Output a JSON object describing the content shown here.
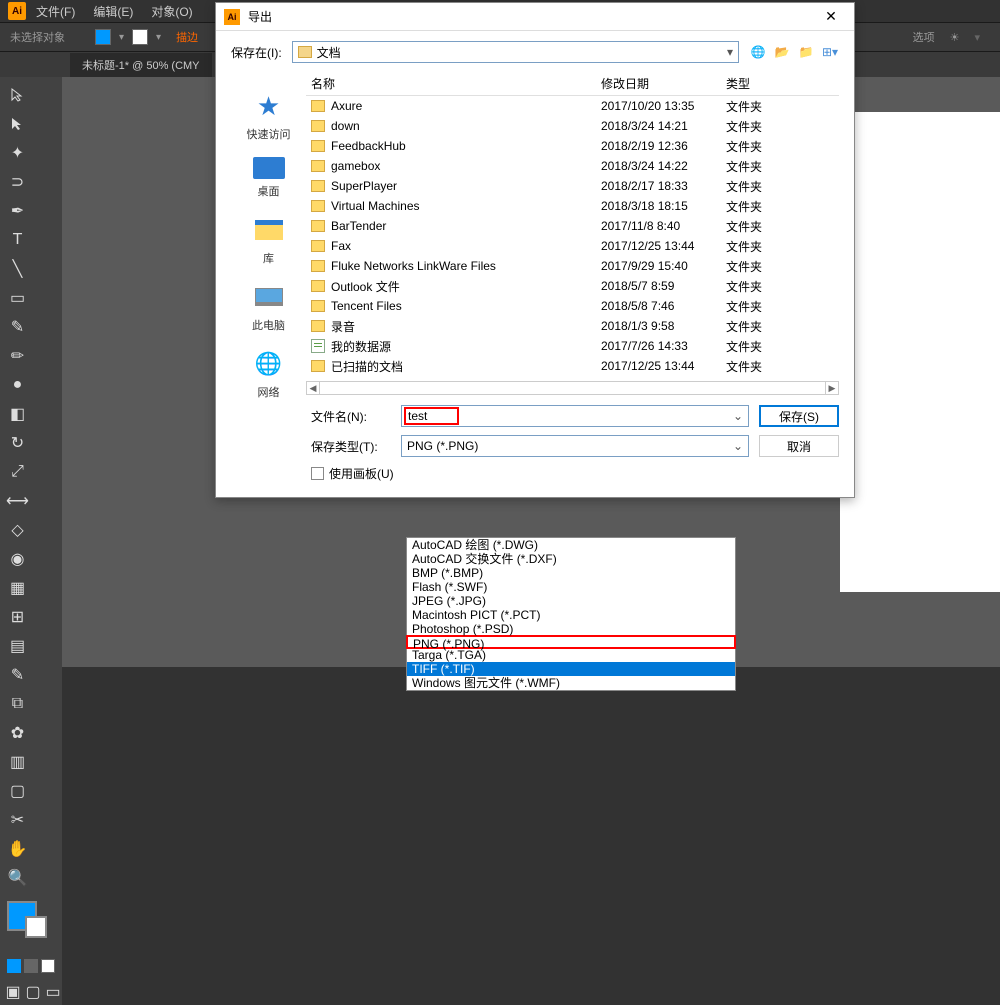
{
  "app": {
    "menu": [
      "文件(F)",
      "编辑(E)",
      "对象(O)"
    ],
    "no_selection": "未选择对象",
    "highlight": "描边",
    "right_opts": "选项",
    "doc_tab": "未标题-1* @ 50% (CMY"
  },
  "dialog": {
    "title": "导出",
    "save_in_label": "保存在(I):",
    "location": "文档",
    "sidebar": [
      {
        "label": "快速访问",
        "icon": "star"
      },
      {
        "label": "桌面",
        "icon": "desktop"
      },
      {
        "label": "库",
        "icon": "library"
      },
      {
        "label": "此电脑",
        "icon": "computer"
      },
      {
        "label": "网络",
        "icon": "network"
      }
    ],
    "headers": {
      "name": "名称",
      "date": "修改日期",
      "type": "类型"
    },
    "files": [
      {
        "name": "Axure",
        "date": "2017/10/20 13:35",
        "type": "文件夹"
      },
      {
        "name": "down",
        "date": "2018/3/24 14:21",
        "type": "文件夹"
      },
      {
        "name": "FeedbackHub",
        "date": "2018/2/19 12:36",
        "type": "文件夹"
      },
      {
        "name": "gamebox",
        "date": "2018/3/24 14:22",
        "type": "文件夹"
      },
      {
        "name": "SuperPlayer",
        "date": "2018/2/17 18:33",
        "type": "文件夹"
      },
      {
        "name": "Virtual Machines",
        "date": "2018/3/18 18:15",
        "type": "文件夹"
      },
      {
        "name": "BarTender",
        "date": "2017/11/8 8:40",
        "type": "文件夹"
      },
      {
        "name": "Fax",
        "date": "2017/12/25 13:44",
        "type": "文件夹"
      },
      {
        "name": "Fluke Networks LinkWare Files",
        "date": "2017/9/29 15:40",
        "type": "文件夹"
      },
      {
        "name": "Outlook 文件",
        "date": "2018/5/7 8:59",
        "type": "文件夹"
      },
      {
        "name": "Tencent Files",
        "date": "2018/5/8 7:46",
        "type": "文件夹"
      },
      {
        "name": "录音",
        "date": "2018/1/3 9:58",
        "type": "文件夹"
      },
      {
        "name": "我的数据源",
        "date": "2017/7/26 14:33",
        "type": "文件夹",
        "icon": "file"
      },
      {
        "name": "已扫描的文档",
        "date": "2017/12/25 13:44",
        "type": "文件夹"
      }
    ],
    "filename_label": "文件名(N):",
    "filename_value": "test",
    "filetype_label": "保存类型(T):",
    "filetype_value": "PNG (*.PNG)",
    "save_btn": "保存(S)",
    "cancel_btn": "取消",
    "use_artboards": "使用画板(U)",
    "dropdown_options": [
      "AutoCAD 绘图 (*.DWG)",
      "AutoCAD 交换文件 (*.DXF)",
      "BMP (*.BMP)",
      "Flash (*.SWF)",
      "JPEG (*.JPG)",
      "Macintosh PICT (*.PCT)",
      "Photoshop (*.PSD)",
      "PNG (*.PNG)",
      "Targa (*.TGA)",
      "TIFF (*.TIF)",
      "Windows 图元文件 (*.WMF)"
    ]
  }
}
